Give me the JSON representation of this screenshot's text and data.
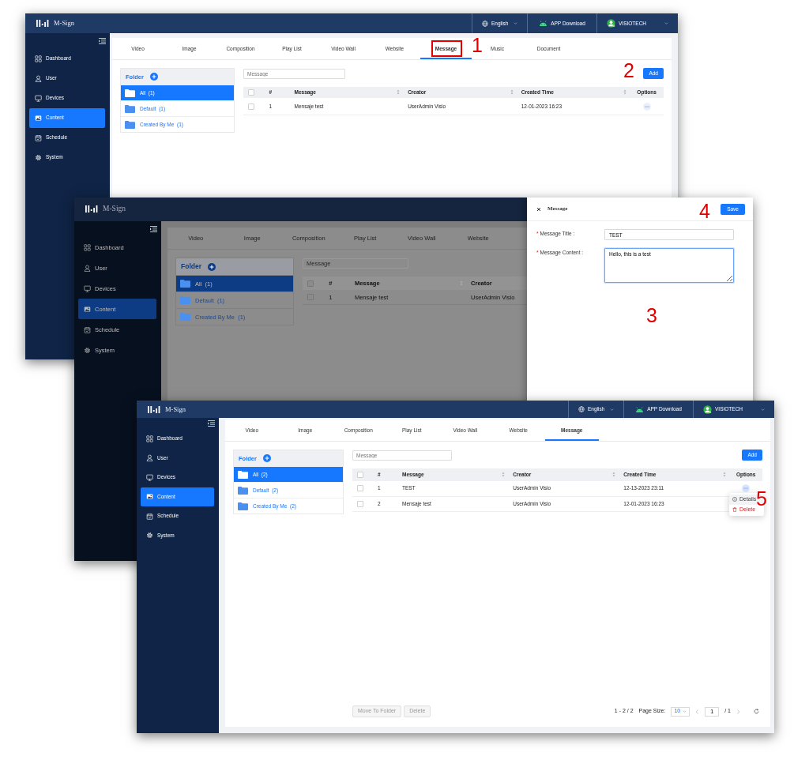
{
  "screenshots": [
    {
      "dimmed": false,
      "header": {
        "brand": "M-Sign",
        "language": "English",
        "app_download": "APP Download",
        "user": "VISIOTECH"
      },
      "sidebar": [
        {
          "label": "Dashboard",
          "selected": false
        },
        {
          "label": "User",
          "selected": false
        },
        {
          "label": "Devices",
          "selected": false
        },
        {
          "label": "Content",
          "selected": true
        },
        {
          "label": "Schedule",
          "selected": false
        },
        {
          "label": "System",
          "selected": false
        }
      ],
      "tabs": [
        {
          "label": "Video",
          "selected": false,
          "annotated": false
        },
        {
          "label": "Image",
          "selected": false,
          "annotated": false
        },
        {
          "label": "Composition",
          "selected": false,
          "annotated": false
        },
        {
          "label": "Play List",
          "selected": false,
          "annotated": false
        },
        {
          "label": "Video Wall",
          "selected": false,
          "annotated": false
        },
        {
          "label": "Website",
          "selected": false,
          "annotated": false
        },
        {
          "label": "Message",
          "selected": true,
          "annotated": true
        },
        {
          "label": "Music",
          "selected": false,
          "annotated": false
        },
        {
          "label": "Document",
          "selected": false,
          "annotated": false
        }
      ],
      "folder_title": "Folder",
      "folders": [
        {
          "name": "All",
          "count": "(1)",
          "selected": true
        },
        {
          "name": "Default",
          "count": "(1)",
          "selected": false
        },
        {
          "name": "Created By Me",
          "count": "(1)",
          "selected": false
        }
      ],
      "search": {
        "placeholder": "Message"
      },
      "add_button": "Add",
      "table": {
        "all_checked": false,
        "columns": [
          {
            "label": "#",
            "sortable": false
          },
          {
            "label": "Message",
            "sortable": true
          },
          {
            "label": "Creator",
            "sortable": true
          },
          {
            "label": "Created Time",
            "sortable": true
          },
          {
            "label": "Options",
            "sortable": false
          }
        ],
        "rows": [
          {
            "checked": false,
            "cells": [
              "1",
              "Mensaje test",
              "UserAdmin Visio",
              "12-01-2023 16:23"
            ]
          }
        ]
      }
    },
    {
      "dimmed": true,
      "header": {
        "brand": "M-Sign"
      },
      "sidebar": [
        {
          "label": "Dashboard",
          "selected": false
        },
        {
          "label": "User",
          "selected": false
        },
        {
          "label": "Devices",
          "selected": false
        },
        {
          "label": "Content",
          "selected": true
        },
        {
          "label": "Schedule",
          "selected": false
        },
        {
          "label": "System",
          "selected": false
        }
      ],
      "tabs": [
        {
          "label": "Video",
          "selected": false,
          "annotated": false
        },
        {
          "label": "Image",
          "selected": false,
          "annotated": false
        },
        {
          "label": "Composition",
          "selected": false,
          "annotated": false
        },
        {
          "label": "Play List",
          "selected": false,
          "annotated": false
        },
        {
          "label": "Video Wall",
          "selected": false,
          "annotated": false
        },
        {
          "label": "Website",
          "selected": false,
          "annotated": false
        }
      ],
      "folder_title": "Folder",
      "folders": [
        {
          "name": "All",
          "count": "(1)",
          "selected": true
        },
        {
          "name": "Default",
          "count": "(1)",
          "selected": false
        },
        {
          "name": "Created By Me",
          "count": "(1)",
          "selected": false
        }
      ],
      "search": {
        "placeholder": "Message"
      },
      "table": {
        "all_checked": false,
        "columns": [
          {
            "label": "#",
            "sortable": false
          },
          {
            "label": "Message",
            "sortable": true
          },
          {
            "label": "Creator",
            "sortable": false
          }
        ],
        "rows": [
          {
            "checked": false,
            "cells": [
              "1",
              "Mensaje test",
              "UserAdmin Visio"
            ]
          }
        ]
      },
      "drawer": {
        "title": "Message",
        "save_button": "Save",
        "fields": [
          {
            "kind": "input",
            "required_mark": "*",
            "label": "Message Title :",
            "value": "TEST"
          },
          {
            "kind": "textarea",
            "required_mark": "*",
            "label": "Message Content :",
            "value": "Hello, this is a test"
          }
        ]
      }
    },
    {
      "dimmed": false,
      "header": {
        "brand": "M-Sign",
        "language": "English",
        "app_download": "APP Download",
        "user": "VISIOTECH"
      },
      "sidebar": [
        {
          "label": "Dashboard",
          "selected": false
        },
        {
          "label": "User",
          "selected": false
        },
        {
          "label": "Devices",
          "selected": false
        },
        {
          "label": "Content",
          "selected": true
        },
        {
          "label": "Schedule",
          "selected": false
        },
        {
          "label": "System",
          "selected": false
        }
      ],
      "tabs": [
        {
          "label": "Video",
          "selected": false,
          "annotated": false
        },
        {
          "label": "Image",
          "selected": false,
          "annotated": false
        },
        {
          "label": "Composition",
          "selected": false,
          "annotated": false
        },
        {
          "label": "Play List",
          "selected": false,
          "annotated": false
        },
        {
          "label": "Video Wall",
          "selected": false,
          "annotated": false
        },
        {
          "label": "Website",
          "selected": false,
          "annotated": false
        },
        {
          "label": "Message",
          "selected": true,
          "annotated": false
        }
      ],
      "folder_title": "Folder",
      "folders": [
        {
          "name": "All",
          "count": "(2)",
          "selected": true
        },
        {
          "name": "Default",
          "count": "(2)",
          "selected": false
        },
        {
          "name": "Created By Me",
          "count": "(2)",
          "selected": false
        }
      ],
      "search": {
        "placeholder": "Message"
      },
      "add_button": "Add",
      "table": {
        "all_checked": false,
        "columns": [
          {
            "label": "#",
            "sortable": false
          },
          {
            "label": "Message",
            "sortable": true
          },
          {
            "label": "Creator",
            "sortable": true
          },
          {
            "label": "Created Time",
            "sortable": true
          },
          {
            "label": "Options",
            "sortable": false
          }
        ],
        "rows": [
          {
            "checked": false,
            "cells": [
              "1",
              "TEST",
              "UserAdmin Visio",
              "12-13-2023 23:11"
            ],
            "menu": [
              {
                "kind": "details",
                "label": "Details"
              },
              {
                "kind": "delete",
                "label": "Delete"
              }
            ]
          },
          {
            "checked": false,
            "cells": [
              "2",
              "Mensaje test",
              "UserAdmin Visio",
              "12-01-2023 16:23"
            ]
          }
        ]
      },
      "bulk_actions": [
        {
          "label": "Move To Folder",
          "disabled": true
        },
        {
          "label": "Delete",
          "disabled": true
        }
      ],
      "pagination": {
        "range": "1 - 2 / 2",
        "page_size_label": "Page Size:",
        "page_size": "10",
        "page": "1",
        "total": "/ 1"
      }
    }
  ],
  "annotations": [
    {
      "text": "1"
    },
    {
      "text": "2"
    },
    {
      "text": "3"
    },
    {
      "text": "4"
    },
    {
      "text": "5"
    }
  ]
}
